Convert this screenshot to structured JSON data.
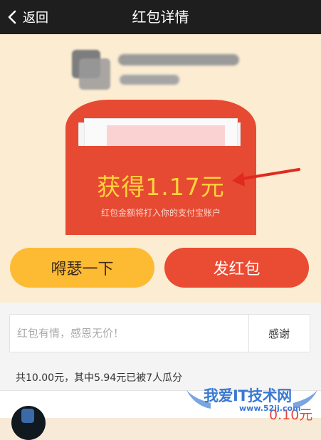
{
  "header": {
    "back_label": "返回",
    "title": "红包详情"
  },
  "envelope": {
    "amount_text": "获得1.17元",
    "subtitle": "红包金额将打入你的支付宝账户"
  },
  "buttons": {
    "left_label": "嘚瑟一下",
    "right_label": "发红包"
  },
  "thanks": {
    "placeholder": "红包有情，感恩无价！",
    "button_label": "感谢"
  },
  "summary_text": "共10.00元，其中5.94元已被7人瓜分",
  "first_entry": {
    "amount": "0.10元"
  },
  "watermark": {
    "text": "我爱IT技术网",
    "url": "www.52ij.com"
  },
  "colors": {
    "header_bg": "#1e1e1e",
    "envelope_red": "#e74a32",
    "amount_yellow": "#ffd43b",
    "button_yellow": "#fdbb34",
    "button_red": "#ea4b33"
  }
}
